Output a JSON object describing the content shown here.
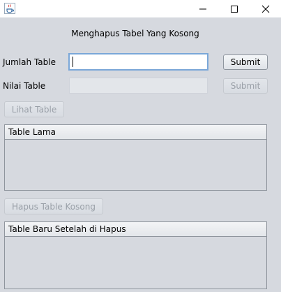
{
  "window": {
    "title": "",
    "icons": {
      "app": "java-cup-icon",
      "minimize": "minimize-icon",
      "maximize": "maximize-icon",
      "close": "close-icon"
    }
  },
  "form": {
    "heading": "Menghapus Tabel Yang Kosong",
    "jumlah_label": "Jumlah Table",
    "jumlah_value": "",
    "jumlah_submit": "Submit",
    "nilai_label": "Nilai Table",
    "nilai_value": "",
    "nilai_submit": "Submit",
    "lihat_button": "Lihat Table",
    "table_lama_header": "Table Lama",
    "hapus_button": "Hapus Table Kosong",
    "table_baru_header": "Table Baru Setelah di Hapus"
  },
  "colors": {
    "background": "#d6d9df",
    "focus_border": "#7aa7d8",
    "disabled_text": "#9aa0a8"
  }
}
